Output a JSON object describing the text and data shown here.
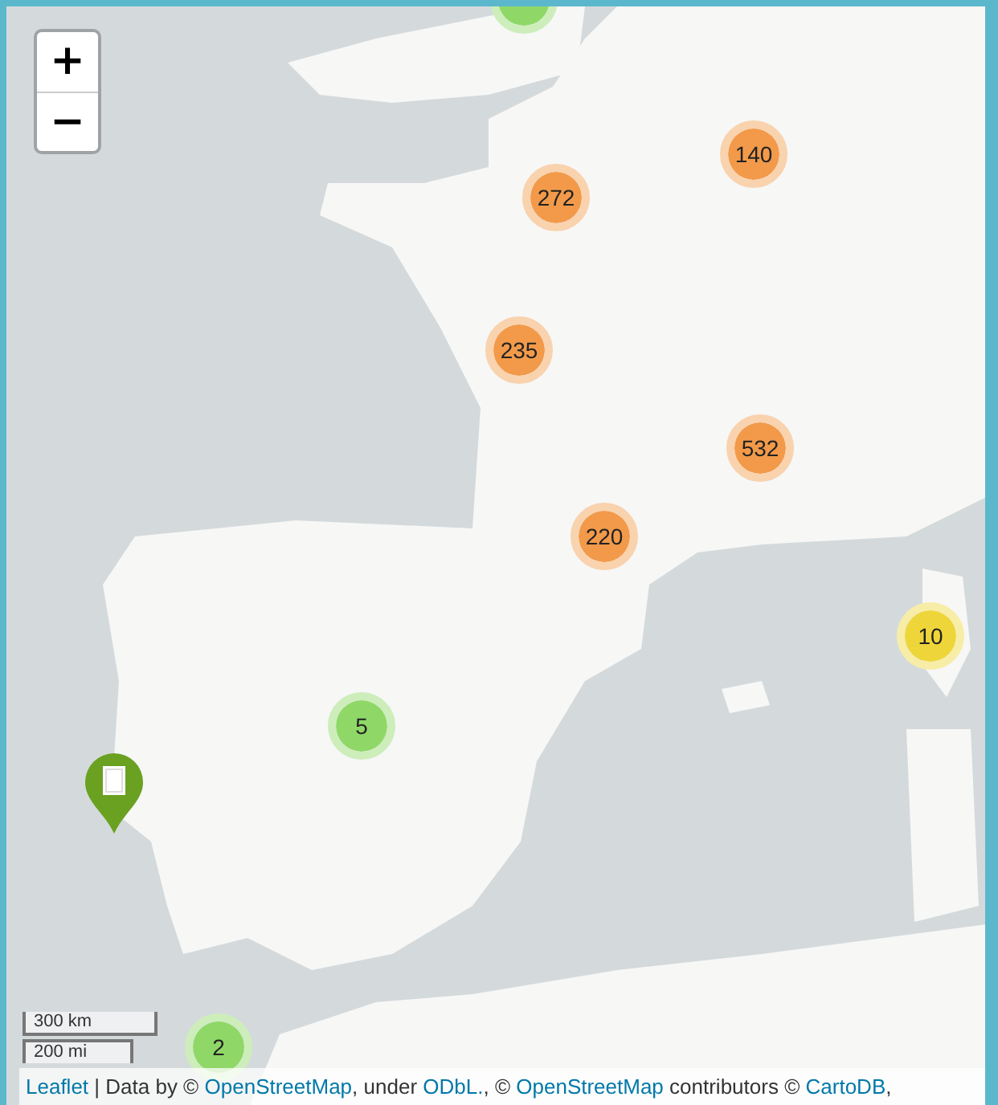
{
  "map": {
    "zoom_controls": [
      {
        "label": "+",
        "kind": "zoom-in"
      },
      {
        "label": "−",
        "kind": "zoom-out"
      }
    ],
    "clusters": [
      {
        "color": "#8fd867"
      },
      {
        "count": "272",
        "color": "#f29a4a"
      },
      {
        "count": "140",
        "color": "#f29a4a"
      },
      {
        "count": "235",
        "color": "#f29a4a"
      },
      {
        "count": "532",
        "color": "#f29a4a"
      },
      {
        "count": "220",
        "color": "#f29a4a"
      },
      {
        "count": "10",
        "color": "#eed63a"
      },
      {
        "count": "5",
        "color": "#8fd867"
      },
      {
        "count": "2",
        "color": "#8fd867"
      }
    ],
    "scale": {
      "metric": "300 km",
      "imperial": "200 mi"
    },
    "attribution": [
      {
        "text": "Leaflet",
        "kind": "link"
      },
      {
        "text": " | Data by © ",
        "kind": "text"
      },
      {
        "text": "OpenStreetMap",
        "kind": "link"
      },
      {
        "text": ", under ",
        "kind": "text"
      },
      {
        "text": "ODbL.",
        "kind": "link"
      },
      {
        "text": ", © ",
        "kind": "text"
      },
      {
        "text": "OpenStreetMap",
        "kind": "link"
      },
      {
        "text": " contributors © ",
        "kind": "text"
      },
      {
        "text": "CartoDB",
        "kind": "link"
      },
      {
        "text": ",",
        "kind": "text"
      }
    ]
  }
}
